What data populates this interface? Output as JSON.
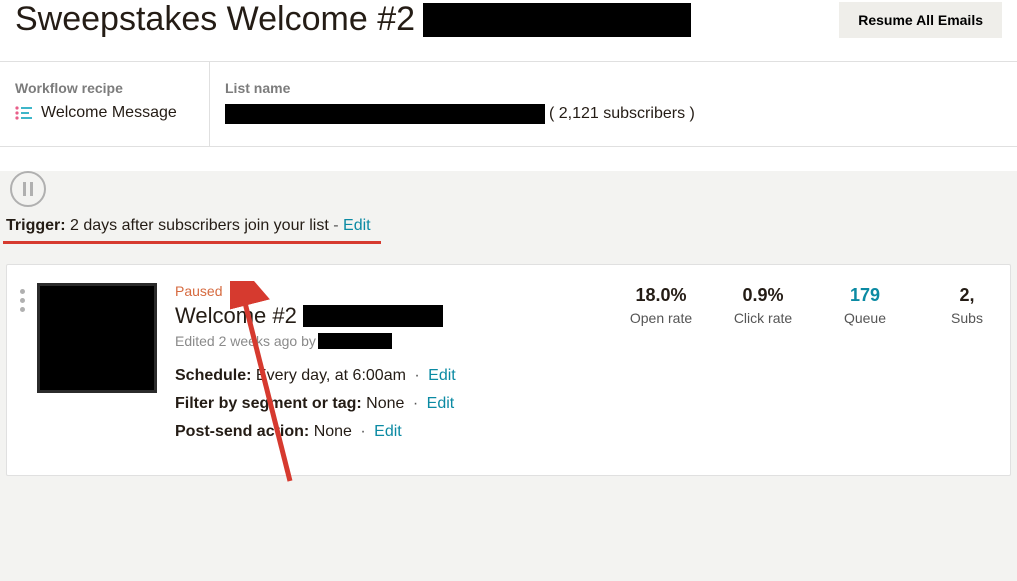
{
  "header": {
    "title": "Sweepstakes Welcome #2",
    "resume_btn": "Resume All Emails"
  },
  "meta": {
    "recipe_label": "Workflow recipe",
    "recipe_value": "Welcome Message",
    "list_label": "List name",
    "subscribers_text": "( 2,121 subscribers )"
  },
  "trigger": {
    "label": "Trigger:",
    "text": "2 days after subscribers join your list",
    "dash": "-",
    "edit": "Edit"
  },
  "email": {
    "status": "Paused",
    "name_prefix": "Welcome #2",
    "edited_prefix": "Edited 2 weeks ago by",
    "schedule_label": "Schedule:",
    "schedule_value": "Every day, at 6:00am",
    "filter_label": "Filter by segment or tag:",
    "filter_value": "None",
    "post_label": "Post-send action:",
    "post_value": "None",
    "dot": "·",
    "edit": "Edit"
  },
  "stats": {
    "open_val": "18.0%",
    "open_lbl": "Open rate",
    "click_val": "0.9%",
    "click_lbl": "Click rate",
    "queue_val": "179",
    "queue_lbl": "Queue",
    "subs_val": "2,",
    "subs_lbl": "Subs"
  }
}
